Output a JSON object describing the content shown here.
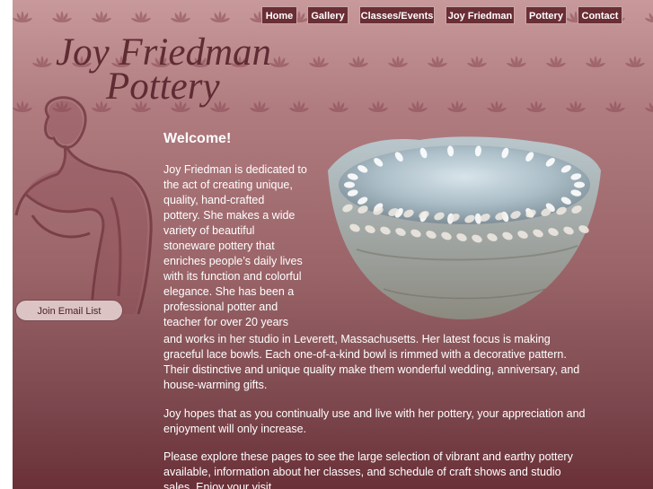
{
  "nav": {
    "items": [
      {
        "label": "Home"
      },
      {
        "label": "Gallery"
      },
      {
        "label": "Classes/Events"
      },
      {
        "label": "Joy Friedman"
      },
      {
        "label": "Pottery"
      },
      {
        "label": "Contact"
      }
    ]
  },
  "logo": {
    "line1": "Joy Friedman",
    "line2": "Pottery"
  },
  "sidebar": {
    "email_button": "Join Email List"
  },
  "main": {
    "heading": "Welcome!",
    "lines": [
      "Joy Friedman is dedicated to",
      "the act of creating unique,",
      "quality, hand-crafted",
      "pottery.  She makes a wide",
      "variety of beautiful",
      "stoneware pottery that",
      "enriches people’s daily lives",
      "with its function and colorful",
      "elegance.  She has been a",
      "professional potter and",
      "teacher for over 20 years",
      "and works in her studio in Leverett, Massachusetts. Her latest focus is making",
      "graceful lace bowls.  Each one-of-a-kind bowl is rimmed with a decorative pattern.",
      "Their distinctive and unique quality make them wonderful wedding, anniversary, and",
      "house-warming gifts.",
      "Joy hopes that as you continually use and live with her pottery, your appreciation and",
      "enjoyment will only increase.",
      "Please explore these pages to see the large selection of vibrant and earthy pottery",
      "available, information about her classes, and schedule of craft shows and studio",
      "sales.  Enjoy your visit."
    ]
  },
  "colors": {
    "accent": "#6a2e35",
    "background_top": "#c8999a",
    "background_bottom": "#6a3038"
  }
}
